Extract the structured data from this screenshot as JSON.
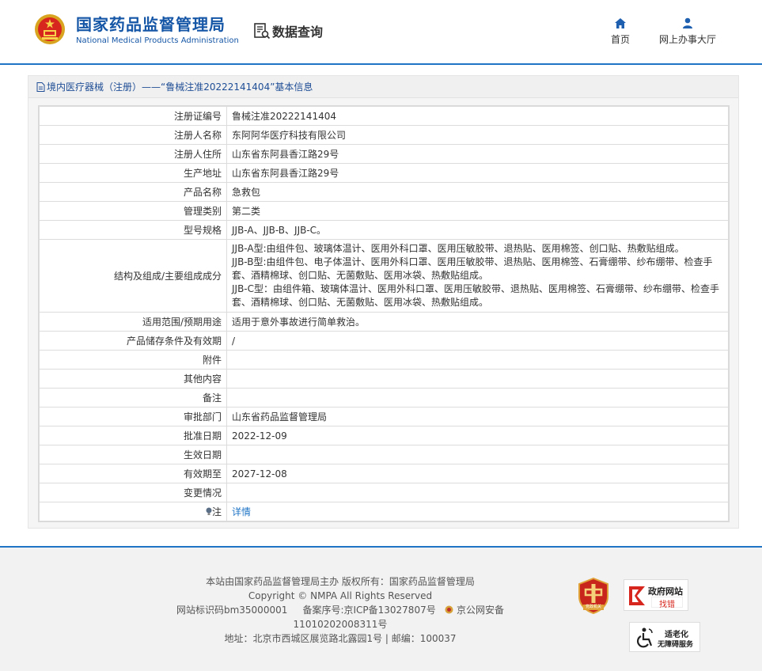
{
  "header": {
    "site_name_cn": "国家药品监督管理局",
    "site_name_en": "National Medical Products Administration",
    "query_label": "数据查询",
    "nav": [
      {
        "label": "首页",
        "icon": "home-icon"
      },
      {
        "label": "网上办事大厅",
        "icon": "user-icon"
      }
    ]
  },
  "breadcrumb": "境内医疗器械（注册）——“鲁械注准20222141404”基本信息",
  "rows": [
    {
      "label": "注册证编号",
      "value": "鲁械注准20222141404"
    },
    {
      "label": "注册人名称",
      "value": "东阿阿华医疗科技有限公司"
    },
    {
      "label": "注册人住所",
      "value": "山东省东阿县香江路29号"
    },
    {
      "label": "生产地址",
      "value": "山东省东阿县香江路29号"
    },
    {
      "label": "产品名称",
      "value": "急救包"
    },
    {
      "label": "管理类别",
      "value": "第二类"
    },
    {
      "label": "型号规格",
      "value": "JJB-A、JJB-B、JJB-C。"
    },
    {
      "label": "结构及组成/主要组成成分",
      "lines": [
        "JJB-A型:由组件包、玻璃体温计、医用外科口罩、医用压敏胶带、退热贴、医用棉签、创口贴、热敷贴组成。",
        "JJB-B型:由组件包、电子体温计、医用外科口罩、医用压敏胶带、退热贴、医用棉签、石膏绷带、纱布绷带、检查手套、酒精棉球、创口贴、无菌敷贴、医用冰袋、热敷贴组成。",
        "JJB-C型：由组件箱、玻璃体温计、医用外科口罩、医用压敏胶带、退热贴、医用棉签、石膏绷带、纱布绷带、检查手套、酒精棉球、创口贴、无菌敷贴、医用冰袋、热敷贴组成。"
      ]
    },
    {
      "label": "适用范围/预期用途",
      "value": "适用于意外事故进行简单救治。"
    },
    {
      "label": "产品储存条件及有效期",
      "value": "/"
    },
    {
      "label": "附件",
      "value": ""
    },
    {
      "label": "其他内容",
      "value": ""
    },
    {
      "label": "备注",
      "value": ""
    },
    {
      "label": "审批部门",
      "value": "山东省药品监督管理局"
    },
    {
      "label": "批准日期",
      "value": "2022-12-09"
    },
    {
      "label": "生效日期",
      "value": ""
    },
    {
      "label": "有效期至",
      "value": "2027-12-08"
    },
    {
      "label": "变更情况",
      "value": ""
    },
    {
      "label": "注",
      "value": "详情",
      "link": true
    }
  ],
  "footer": {
    "line1": "本站由国家药品监督管理局主办 版权所有：国家药品监督管理局",
    "line2": "Copyright © NMPA All Rights Reserved",
    "line3a": "网站标识码bm35000001",
    "line3b": "备案序号:京ICP备13027807号",
    "line3c": "京公网安备11010202008311号",
    "line4": "地址：北京市西城区展览路北露园1号 | 邮编：100037",
    "badge_party": "党政机关",
    "badge_gov_title": "政府网站",
    "badge_gov_sub": "找错",
    "badge_access_title": "适老化",
    "badge_access_sub": "无障碍服务"
  },
  "colors": {
    "brand": "#1556a6",
    "accent": "#1f74c6",
    "link": "#1f74c6"
  }
}
